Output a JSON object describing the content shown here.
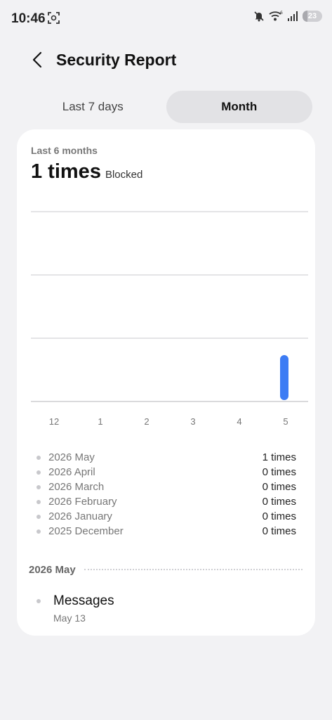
{
  "status_bar": {
    "time": "10:46",
    "battery": "23",
    "icons": [
      "screenshot-icon",
      "mute-icon",
      "wifi-icon",
      "signal-icon",
      "battery-icon"
    ]
  },
  "header": {
    "title": "Security Report",
    "back_icon": "chevron-left-icon"
  },
  "tabs": [
    {
      "label": "Last 7 days",
      "active": false
    },
    {
      "label": "Month",
      "active": true
    }
  ],
  "card": {
    "period_label": "Last 6 months",
    "total_value": "1 times",
    "total_label": "Blocked"
  },
  "chart_data": {
    "type": "bar",
    "categories": [
      "12",
      "1",
      "2",
      "3",
      "4",
      "5"
    ],
    "values": [
      0,
      0,
      0,
      0,
      0,
      1
    ],
    "ylim": [
      0,
      3
    ],
    "grid": true,
    "bar_color": "#3d7cf4"
  },
  "summary": [
    {
      "month": "2026 May",
      "count": "1 times"
    },
    {
      "month": "2026 April",
      "count": "0 times"
    },
    {
      "month": "2026 March",
      "count": "0 times"
    },
    {
      "month": "2026 February",
      "count": "0 times"
    },
    {
      "month": "2026 January",
      "count": "0 times"
    },
    {
      "month": "2025 December",
      "count": "0 times"
    }
  ],
  "section": {
    "label": "2026 May"
  },
  "entries": [
    {
      "title": "Messages",
      "date": "May 13"
    }
  ]
}
